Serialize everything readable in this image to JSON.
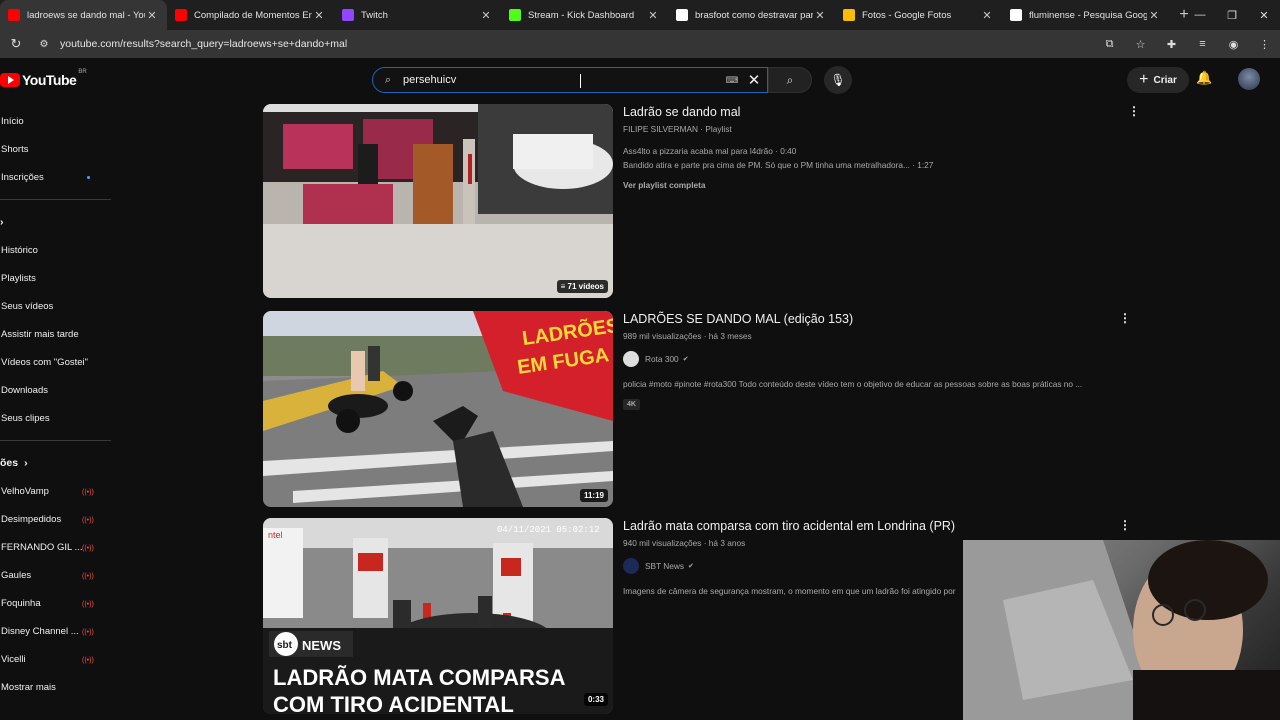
{
  "browser": {
    "tabs": [
      {
        "title": "ladroews se dando mal - YouTube",
        "icon": "youtube-icon",
        "color": "#ff0000",
        "active": true
      },
      {
        "title": "Compilado de Momentos Engr",
        "icon": "youtube-icon",
        "color": "#ff0000",
        "active": false
      },
      {
        "title": "Twitch",
        "icon": "twitch-icon",
        "color": "#9146ff",
        "active": false
      },
      {
        "title": "Stream - Kick Dashboard",
        "icon": "kick-icon",
        "color": "#53fc18",
        "active": false
      },
      {
        "title": "brasfoot como destravar para",
        "icon": "google-icon",
        "color": "#ffffff",
        "active": false
      },
      {
        "title": "Fotos - Google Fotos",
        "icon": "google-photos-icon",
        "color": "#fbbc04",
        "active": false
      },
      {
        "title": "fluminense - Pesquisa Google",
        "icon": "google-icon",
        "color": "#ffffff",
        "active": false
      }
    ],
    "url": "youtube.com/results?search_query=ladroews+se+dando+mal"
  },
  "youtube": {
    "logo_text": "YouTube",
    "country_code": "BR",
    "search_value": "persehuicv",
    "create_label": "Criar"
  },
  "sidebar": {
    "main": [
      "Início",
      "Shorts",
      "Inscrições"
    ],
    "you_items": [
      "Histórico",
      "Playlists",
      "Seus vídeos",
      "Assistir mais tarde",
      "Vídeos com \"Gostei\"",
      "Downloads",
      "Seus clipes"
    ],
    "subs_header": "ões",
    "subs": [
      "VelhoVamp",
      "Desimpedidos",
      "FERNANDO GIL ...",
      "Gaules",
      "Foquinha",
      "Disney Channel ...",
      "Vicelli"
    ],
    "more": "Mostrar mais"
  },
  "results": [
    {
      "title": "Ladrão se dando mal",
      "channel": "FILIPE SILVERMAN",
      "kind": "Playlist",
      "line1": "Ass4lto a pizzaria acaba mal para l4drão · 0:40",
      "line2": "Bandido atira e parte pra cima de PM. Só que o PM tinha uma metralhadora... · 1:27",
      "link": "Ver playlist completa",
      "duration": "71 vídeos"
    },
    {
      "title": "LADRÕES SE DANDO MAL (edição 153)",
      "views": "989 mil visualizações",
      "age": "há 3 meses",
      "channel": "Rota 300",
      "desc": "policia #moto #pinote #rota300 Todo conteúdo deste vídeo tem o objetivo de educar as pessoas sobre as boas práticas no ...",
      "badge": "4K",
      "duration": "11:19",
      "thumb_text": "LADRÕES EM FUGA"
    },
    {
      "title": "Ladrão mata comparsa com tiro acidental em Londrina (PR)",
      "views": "940 mil visualizações",
      "age": "há 3 anos",
      "channel": "SBT News",
      "desc": "Imagens de câmera de segurança mostram, o momento em que um ladrão foi atingido por",
      "duration": "0:33",
      "thumb_text": "LADRÃO MATA COMPARSA COM TIRO ACIDENTAL",
      "thumb_logo": "sbt NEWS",
      "thumb_timestamp": "04/11/2021 05:02:12"
    }
  ]
}
